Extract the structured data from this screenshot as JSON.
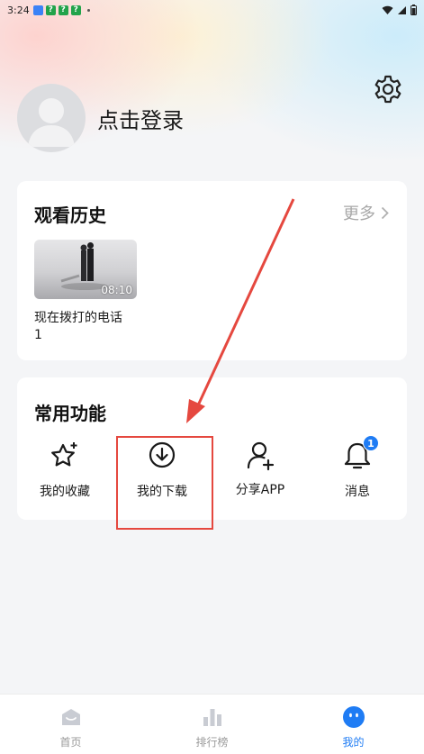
{
  "status_bar": {
    "time": "3:24",
    "notification_icons": [
      "app-notify-icon",
      "app-notify-icon",
      "app-notify-icon",
      "app-notify-icon"
    ],
    "green_label": "?"
  },
  "profile": {
    "login_text": "点击登录"
  },
  "history": {
    "title": "观看历史",
    "more_label": "更多",
    "items": [
      {
        "duration": "08:10",
        "title": "现在拨打的电话",
        "episode": "1"
      }
    ]
  },
  "functions": {
    "title": "常用功能",
    "items": [
      {
        "label": "我的收藏",
        "icon": "star-icon"
      },
      {
        "label": "我的下载",
        "icon": "download-icon"
      },
      {
        "label": "分享APP",
        "icon": "user-add-icon"
      },
      {
        "label": "消息",
        "icon": "bell-icon",
        "badge": "1"
      }
    ]
  },
  "tabs": [
    {
      "label": "首页",
      "icon": "home-icon",
      "active": false
    },
    {
      "label": "排行榜",
      "icon": "chart-icon",
      "active": false
    },
    {
      "label": "我的",
      "icon": "profile-icon",
      "active": true
    }
  ],
  "colors": {
    "accent": "#1f7cf4",
    "annotation": "#e5483f"
  }
}
